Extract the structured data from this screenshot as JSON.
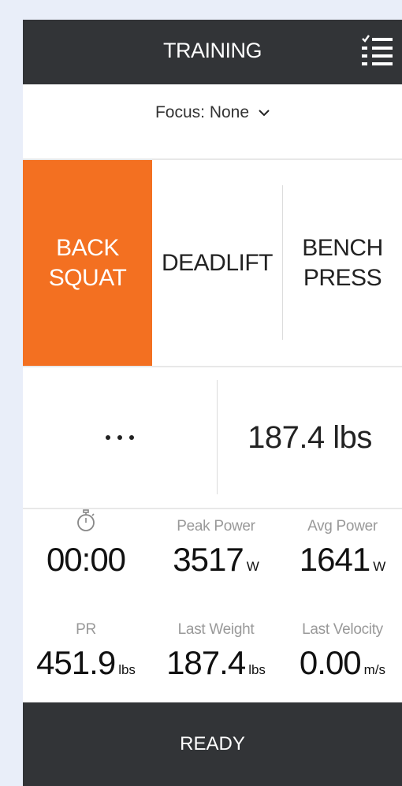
{
  "header": {
    "title": "TRAINING",
    "menu_icon": "checklist-menu-icon"
  },
  "focus": {
    "label": "Focus: None",
    "icon": "chevron-down-icon"
  },
  "exercises": [
    {
      "label": "BACK\nSQUAT",
      "active": true
    },
    {
      "label": "DEADLIFT",
      "active": false
    },
    {
      "label": "BENCH\nPRESS",
      "active": false
    }
  ],
  "weight": {
    "more_icon": "more-dots-icon",
    "value": "187.4 lbs"
  },
  "stats": {
    "timer": {
      "icon": "stopwatch-icon",
      "value": "00:00"
    },
    "peak_power": {
      "label": "Peak Power",
      "value": "3517",
      "unit": "W"
    },
    "avg_power": {
      "label": "Avg Power",
      "value": "1641",
      "unit": "W"
    },
    "pr": {
      "label": "PR",
      "value": "451.9",
      "unit": "lbs"
    },
    "last_weight": {
      "label": "Last Weight",
      "value": "187.4",
      "unit": "lbs"
    },
    "last_velocity": {
      "label": "Last Velocity",
      "value": "0.00",
      "unit": "m/s"
    }
  },
  "ready": {
    "label": "READY"
  },
  "colors": {
    "accent": "#f37021",
    "bar": "#323437",
    "background": "#e9eef9"
  }
}
